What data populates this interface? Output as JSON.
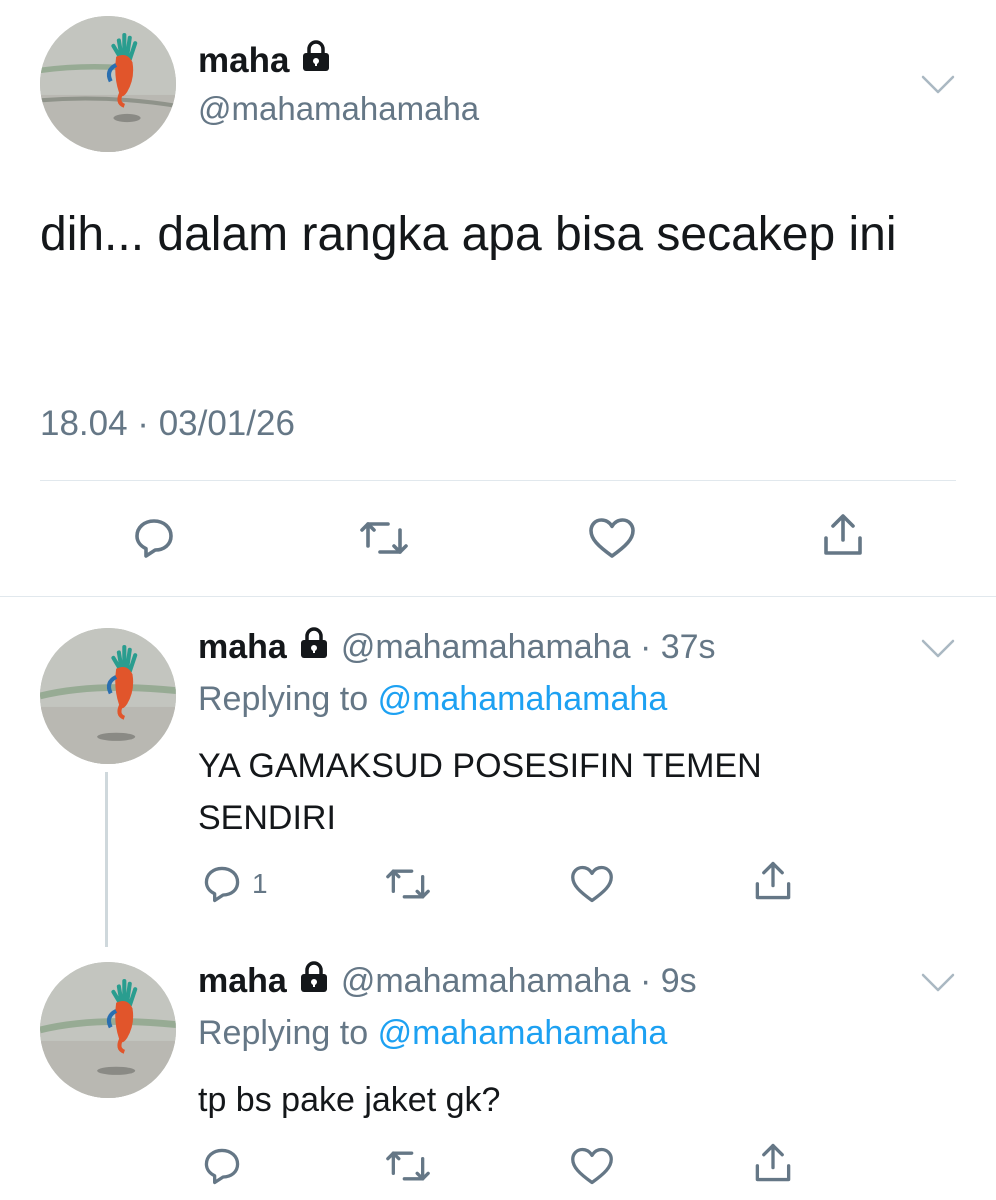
{
  "main_tweet": {
    "display_name": "maha",
    "handle": "@mahamahamaha",
    "text": "dih... dalam rangka apa bisa secakep ini",
    "timestamp": "18.04 · 03/01/26",
    "avatar_icon": "avatar-image",
    "locked_icon": "lock-icon"
  },
  "replies": [
    {
      "display_name": "maha",
      "handle": "@mahamahamaha",
      "time": "37s",
      "replying_prefix": "Replying to",
      "replying_to": "@mahamahamaha",
      "text": "YA GAMAKSUD POSESIFIN TEMEN SENDIRI",
      "reply_count": "1"
    },
    {
      "display_name": "maha",
      "handle": "@mahamahamaha",
      "time": "9s",
      "replying_prefix": "Replying to",
      "replying_to": "@mahamahamaha",
      "text": "tp bs pake jaket gk?",
      "reply_count": ""
    }
  ],
  "colors": {
    "text_primary": "#14171a",
    "text_secondary": "#657786",
    "link": "#1da1f2",
    "divider": "#e1e8ed"
  }
}
